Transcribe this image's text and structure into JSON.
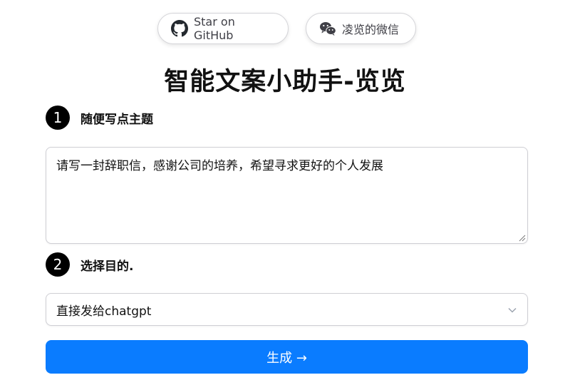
{
  "header": {
    "github_label": "Star on GitHub",
    "wechat_label": "凌览的微信"
  },
  "title": "智能文案小助手-览览",
  "steps": [
    {
      "number": "1",
      "label": "随便写点主题"
    },
    {
      "number": "2",
      "label": "选择目的."
    }
  ],
  "topic_input": {
    "value": "请写一封辞职信，感谢公司的培养，希望寻求更好的个人发展"
  },
  "purpose_select": {
    "selected": "直接发给chatgpt"
  },
  "generate_button": {
    "label": "生成 →"
  },
  "colors": {
    "accent": "#0a7cff",
    "step_badge": "#000000"
  }
}
